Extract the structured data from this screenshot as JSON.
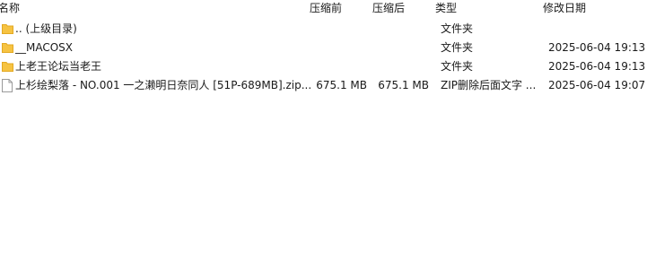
{
  "columns": {
    "name": "名称",
    "size": "压缩前",
    "packed": "压缩后",
    "type": "类型",
    "modified": "修改日期"
  },
  "rows": [
    {
      "icon": "folder-icon",
      "name": ".. (上级目录)",
      "size": "",
      "packed": "",
      "type": "文件夹",
      "modified": ""
    },
    {
      "icon": "folder-icon",
      "name": "__MACOSX",
      "size": "",
      "packed": "",
      "type": "文件夹",
      "modified": "2025-06-04 19:13"
    },
    {
      "icon": "folder-icon",
      "name": "上老王论坛当老王",
      "size": "",
      "packed": "",
      "type": "文件夹",
      "modified": "2025-06-04 19:13"
    },
    {
      "icon": "file-icon",
      "name": "上杉绘梨落 - NO.001 一之濑明日奈同人 [51P-689MB].zip...",
      "size": "675.1 MB",
      "packed": "675.1 MB",
      "type": "ZIP删除后面文字 ...",
      "modified": "2025-06-04 19:07"
    }
  ],
  "colors": {
    "folder": "#f6c342",
    "folder_dark": "#e3a922",
    "file_border": "#9a9a9a"
  }
}
